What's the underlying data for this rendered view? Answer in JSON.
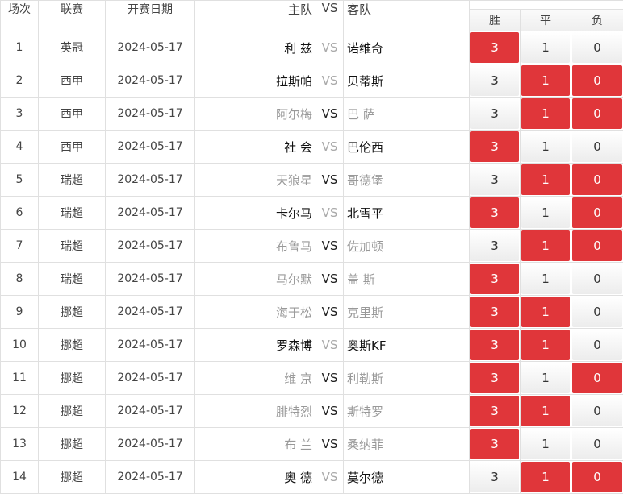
{
  "headers": {
    "num": "场次",
    "league": "联赛",
    "date": "开赛日期",
    "home": "主队",
    "vs": "VS",
    "away": "客队",
    "win": "胜",
    "draw": "平",
    "lose": "负"
  },
  "colors": {
    "selected": "#e0363a",
    "unselected": "#f0f0f0"
  },
  "rows": [
    {
      "num": "1",
      "league": "英冠",
      "date": "2024-05-17",
      "home": "利 兹",
      "away": "诺维奇",
      "win": "3",
      "draw": "1",
      "lose": "0",
      "sel": [
        true,
        false,
        false
      ],
      "dark": true
    },
    {
      "num": "2",
      "league": "西甲",
      "date": "2024-05-17",
      "home": "拉斯帕",
      "away": "贝蒂斯",
      "win": "3",
      "draw": "1",
      "lose": "0",
      "sel": [
        false,
        true,
        true
      ],
      "dark": true
    },
    {
      "num": "3",
      "league": "西甲",
      "date": "2024-05-17",
      "home": "阿尔梅",
      "away": "巴 萨",
      "win": "3",
      "draw": "1",
      "lose": "0",
      "sel": [
        false,
        true,
        true
      ],
      "dark": false
    },
    {
      "num": "4",
      "league": "西甲",
      "date": "2024-05-17",
      "home": "社 会",
      "away": "巴伦西",
      "win": "3",
      "draw": "1",
      "lose": "0",
      "sel": [
        true,
        false,
        false
      ],
      "dark": true
    },
    {
      "num": "5",
      "league": "瑞超",
      "date": "2024-05-17",
      "home": "天狼星",
      "away": "哥德堡",
      "win": "3",
      "draw": "1",
      "lose": "0",
      "sel": [
        false,
        true,
        true
      ],
      "dark": false
    },
    {
      "num": "6",
      "league": "瑞超",
      "date": "2024-05-17",
      "home": "卡尔马",
      "away": "北雪平",
      "win": "3",
      "draw": "1",
      "lose": "0",
      "sel": [
        true,
        false,
        true
      ],
      "dark": true
    },
    {
      "num": "7",
      "league": "瑞超",
      "date": "2024-05-17",
      "home": "布鲁马",
      "away": "佐加顿",
      "win": "3",
      "draw": "1",
      "lose": "0",
      "sel": [
        false,
        true,
        true
      ],
      "dark": false
    },
    {
      "num": "8",
      "league": "瑞超",
      "date": "2024-05-17",
      "home": "马尔默",
      "away": "盖 斯",
      "win": "3",
      "draw": "1",
      "lose": "0",
      "sel": [
        true,
        false,
        false
      ],
      "dark": false
    },
    {
      "num": "9",
      "league": "挪超",
      "date": "2024-05-17",
      "home": "海于松",
      "away": "克里斯",
      "win": "3",
      "draw": "1",
      "lose": "0",
      "sel": [
        true,
        true,
        false
      ],
      "dark": false
    },
    {
      "num": "10",
      "league": "挪超",
      "date": "2024-05-17",
      "home": "罗森博",
      "away": "奥斯KF",
      "win": "3",
      "draw": "1",
      "lose": "0",
      "sel": [
        true,
        true,
        false
      ],
      "dark": true
    },
    {
      "num": "11",
      "league": "挪超",
      "date": "2024-05-17",
      "home": "维 京",
      "away": "利勒斯",
      "win": "3",
      "draw": "1",
      "lose": "0",
      "sel": [
        true,
        false,
        true
      ],
      "dark": false
    },
    {
      "num": "12",
      "league": "挪超",
      "date": "2024-05-17",
      "home": "腓特烈",
      "away": "斯特罗",
      "win": "3",
      "draw": "1",
      "lose": "0",
      "sel": [
        true,
        true,
        false
      ],
      "dark": false
    },
    {
      "num": "13",
      "league": "挪超",
      "date": "2024-05-17",
      "home": "布 兰",
      "away": "桑纳菲",
      "win": "3",
      "draw": "1",
      "lose": "0",
      "sel": [
        true,
        false,
        false
      ],
      "dark": false
    },
    {
      "num": "14",
      "league": "挪超",
      "date": "2024-05-17",
      "home": "奥 德",
      "away": "莫尔德",
      "win": "3",
      "draw": "1",
      "lose": "0",
      "sel": [
        false,
        true,
        true
      ],
      "dark": true
    }
  ]
}
